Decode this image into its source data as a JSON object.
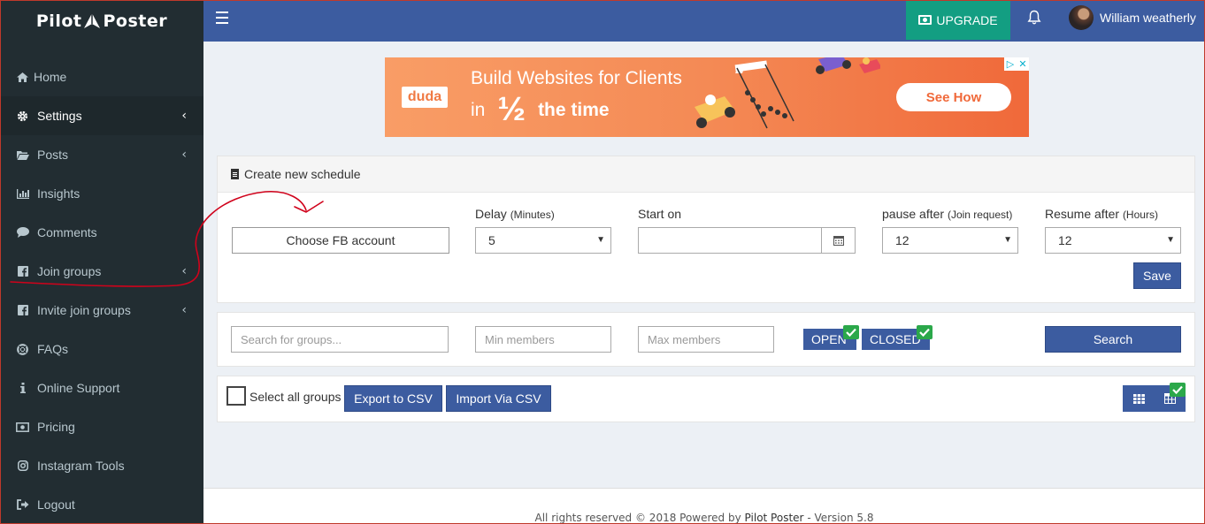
{
  "brand": {
    "left": "Pilot",
    "right": "Poster"
  },
  "sidebar": {
    "items": [
      {
        "label": "Home",
        "icon": "home-icon",
        "has_children": false
      },
      {
        "label": "Settings",
        "icon": "gear-icon",
        "has_children": true,
        "active": true
      },
      {
        "label": "Posts",
        "icon": "folder-open-icon",
        "has_children": true
      },
      {
        "label": "Insights",
        "icon": "bar-chart-icon",
        "has_children": false
      },
      {
        "label": "Comments",
        "icon": "comment-icon",
        "has_children": false
      },
      {
        "label": "Join groups",
        "icon": "facebook-square-icon",
        "has_children": true
      },
      {
        "label": "Invite join groups",
        "icon": "facebook-square-icon",
        "has_children": true
      },
      {
        "label": "FAQs",
        "icon": "life-ring-icon",
        "has_children": false
      },
      {
        "label": "Online Support",
        "icon": "info-icon",
        "has_children": false
      },
      {
        "label": "Pricing",
        "icon": "money-icon",
        "has_children": false
      },
      {
        "label": "Instagram Tools",
        "icon": "instagram-icon",
        "has_children": false
      },
      {
        "label": "Logout",
        "icon": "sign-out-icon",
        "has_children": false
      }
    ]
  },
  "header": {
    "upgrade_label": "UPGRADE",
    "user_name": "William weatherly"
  },
  "ad": {
    "brand": "duda",
    "line1": "Build Websites for Clients",
    "line2_prefix": "in",
    "line2_fraction": "½",
    "line2_suffix": "the time",
    "cta": "See How"
  },
  "schedule": {
    "title": "Create new schedule",
    "choose_account": "Choose FB account",
    "delay_label": "Delay",
    "delay_unit": "(Minutes)",
    "delay_value": "5",
    "start_label": "Start on",
    "start_value": "",
    "pause_label": "pause after",
    "pause_unit": "(Join request)",
    "pause_value": "12",
    "resume_label": "Resume after",
    "resume_unit": "(Hours)",
    "resume_value": "12",
    "save_label": "Save"
  },
  "search": {
    "query_placeholder": "Search for groups...",
    "min_placeholder": "Min members",
    "max_placeholder": "Max members",
    "open_label": "OPEN",
    "closed_label": "CLOSED",
    "open_checked": true,
    "closed_checked": true,
    "search_label": "Search"
  },
  "groups": {
    "select_all_label": "Select all groups",
    "export_label": "Export to CSV",
    "import_label": "Import Via CSV"
  },
  "footer": {
    "prefix": "All rights reserved © 2018 Powered by",
    "brand": "Pilot Poster",
    "version": "- Version 5.8"
  },
  "colors": {
    "sidebar_bg": "#222d32",
    "header_bg": "#3c5ca0",
    "upgrade_bg": "#139e82",
    "check_green": "#2ba84a",
    "annotation_red": "#d0021b"
  }
}
